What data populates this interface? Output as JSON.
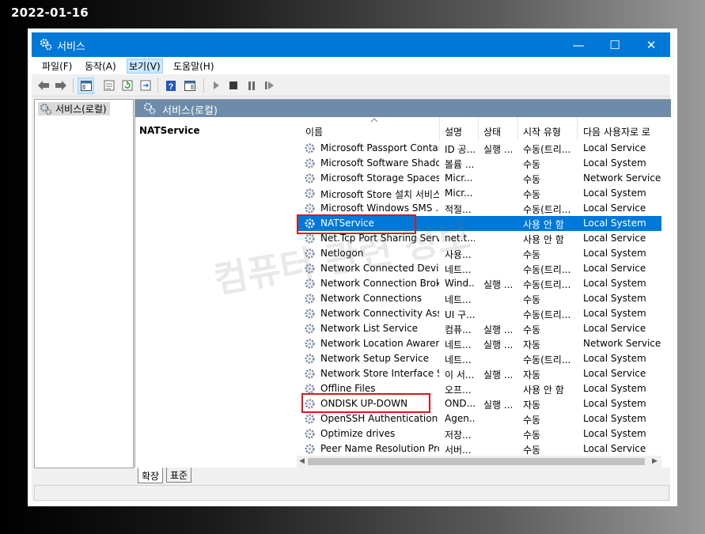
{
  "date_stamp": "2022-01-16",
  "window": {
    "title": "서비스",
    "minimize": "—",
    "maximize": "☐",
    "close": "✕"
  },
  "menu": [
    "파일(F)",
    "동작(A)",
    "보기(V)",
    "도움말(H)"
  ],
  "tree": {
    "root": "서비스(로컬)"
  },
  "pane_header": "서비스(로컬)",
  "selected_service_name": "NATService",
  "columns": [
    "이름",
    "설명",
    "상태",
    "시작 유형",
    "다음 사용자로 로"
  ],
  "services": [
    {
      "name": "Microsoft Passport Container",
      "desc": "ID 공...",
      "status": "실행 ...",
      "startup": "수동(트리...",
      "logon": "Local Service"
    },
    {
      "name": "Microsoft Software Shado...",
      "desc": "볼륨 ...",
      "status": "",
      "startup": "수동",
      "logon": "Local System"
    },
    {
      "name": "Microsoft Storage Spaces ...",
      "desc": "Micr...",
      "status": "",
      "startup": "수동",
      "logon": "Network Service"
    },
    {
      "name": "Microsoft Store 설치 서비스",
      "desc": "Micr...",
      "status": "",
      "startup": "수동",
      "logon": "Local System"
    },
    {
      "name": "Microsoft Windows SMS ...",
      "desc": "적절...",
      "status": "",
      "startup": "수동(트리...",
      "logon": "Local Service"
    },
    {
      "name": "NATService",
      "desc": "",
      "status": "",
      "startup": "사용 안 함",
      "logon": "Local System",
      "selected": true
    },
    {
      "name": "Net.Tcp Port Sharing Service",
      "desc": "net.t...",
      "status": "",
      "startup": "사용 안 함",
      "logon": "Local Service"
    },
    {
      "name": "Netlogon",
      "desc": "사용...",
      "status": "",
      "startup": "수동",
      "logon": "Local System"
    },
    {
      "name": "Network Connected Device...",
      "desc": "네트...",
      "status": "",
      "startup": "수동(트리...",
      "logon": "Local Service"
    },
    {
      "name": "Network Connection Broker",
      "desc": "Wind...",
      "status": "실행 ...",
      "startup": "수동(트리...",
      "logon": "Local System"
    },
    {
      "name": "Network Connections",
      "desc": "네트...",
      "status": "",
      "startup": "수동",
      "logon": "Local System"
    },
    {
      "name": "Network Connectivity Assis...",
      "desc": "UI 구...",
      "status": "",
      "startup": "수동(트리...",
      "logon": "Local System"
    },
    {
      "name": "Network List Service",
      "desc": "컴퓨...",
      "status": "실행 ...",
      "startup": "수동",
      "logon": "Local Service"
    },
    {
      "name": "Network Location Awareness",
      "desc": "네트...",
      "status": "실행 ...",
      "startup": "자동",
      "logon": "Network Service"
    },
    {
      "name": "Network Setup Service",
      "desc": "네트...",
      "status": "",
      "startup": "수동(트리...",
      "logon": "Local System"
    },
    {
      "name": "Network Store Interface Se...",
      "desc": "이 서...",
      "status": "실행 ...",
      "startup": "자동",
      "logon": "Local Service"
    },
    {
      "name": "Offline Files",
      "desc": "오프...",
      "status": "",
      "startup": "사용 안 함",
      "logon": "Local System"
    },
    {
      "name": "ONDISK UP-DOWN",
      "desc": "OND...",
      "status": "실행 ...",
      "startup": "자동",
      "logon": "Local System"
    },
    {
      "name": "OpenSSH Authentication A...",
      "desc": "Agen...",
      "status": "",
      "startup": "수동",
      "logon": "Local System"
    },
    {
      "name": "Optimize drives",
      "desc": "저장...",
      "status": "",
      "startup": "수동",
      "logon": "Local System"
    },
    {
      "name": "Peer Name Resolution Prot...",
      "desc": "서버...",
      "status": "",
      "startup": "수동",
      "logon": "Local Service"
    }
  ],
  "tabs": [
    "확장",
    "표준"
  ],
  "watermark": "컴퓨터 관련 정보",
  "colors": {
    "title_bar": "#0078d7",
    "selection": "#0078d7",
    "highlight_box": "#e0141e",
    "pane_header": "#6e8caa"
  }
}
